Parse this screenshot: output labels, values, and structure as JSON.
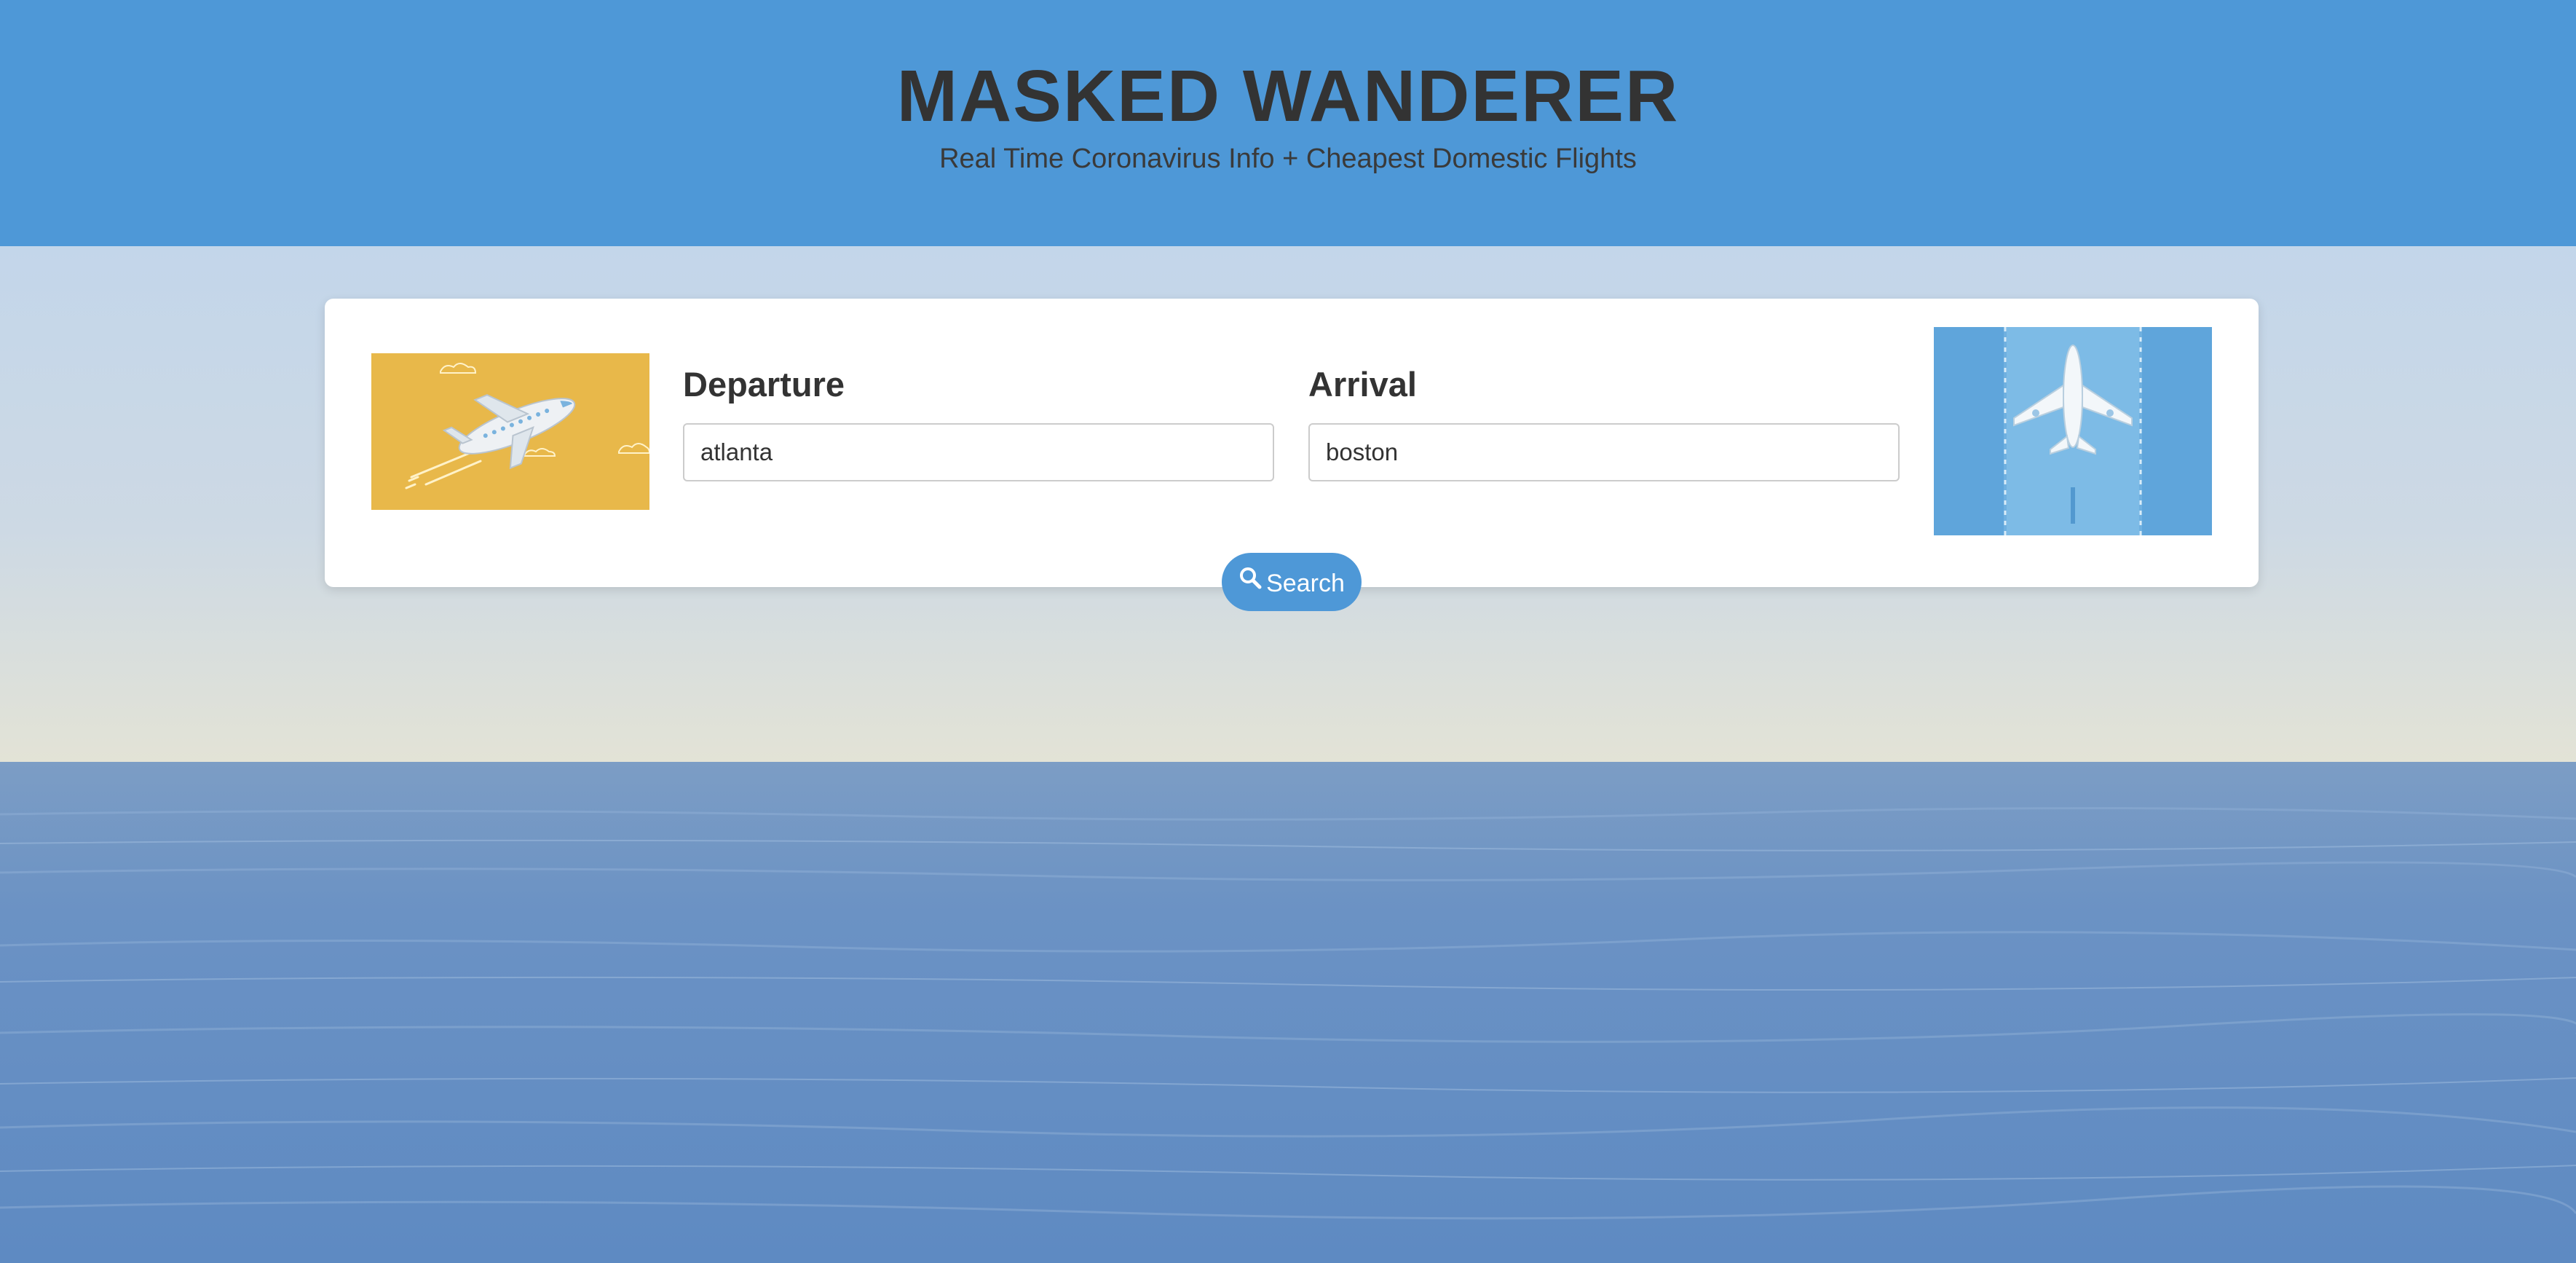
{
  "header": {
    "title": "MASKED WANDERER",
    "subtitle": "Real Time Coronavirus Info + Cheapest Domestic Flights"
  },
  "form": {
    "departure": {
      "label": "Departure",
      "value": "atlanta"
    },
    "arrival": {
      "label": "Arrival",
      "value": "boston"
    },
    "search_button": {
      "label": "Search",
      "icon": "search-icon"
    }
  },
  "images": {
    "left": {
      "icon": "airplane-flying-illustration"
    },
    "right": {
      "icon": "airplane-runway-illustration"
    }
  },
  "colors": {
    "header_bg": "#4e98d7",
    "button_bg": "#4e98d7",
    "left_image_bg": "#e8b84a",
    "right_image_bg": "#6fb0e0"
  }
}
